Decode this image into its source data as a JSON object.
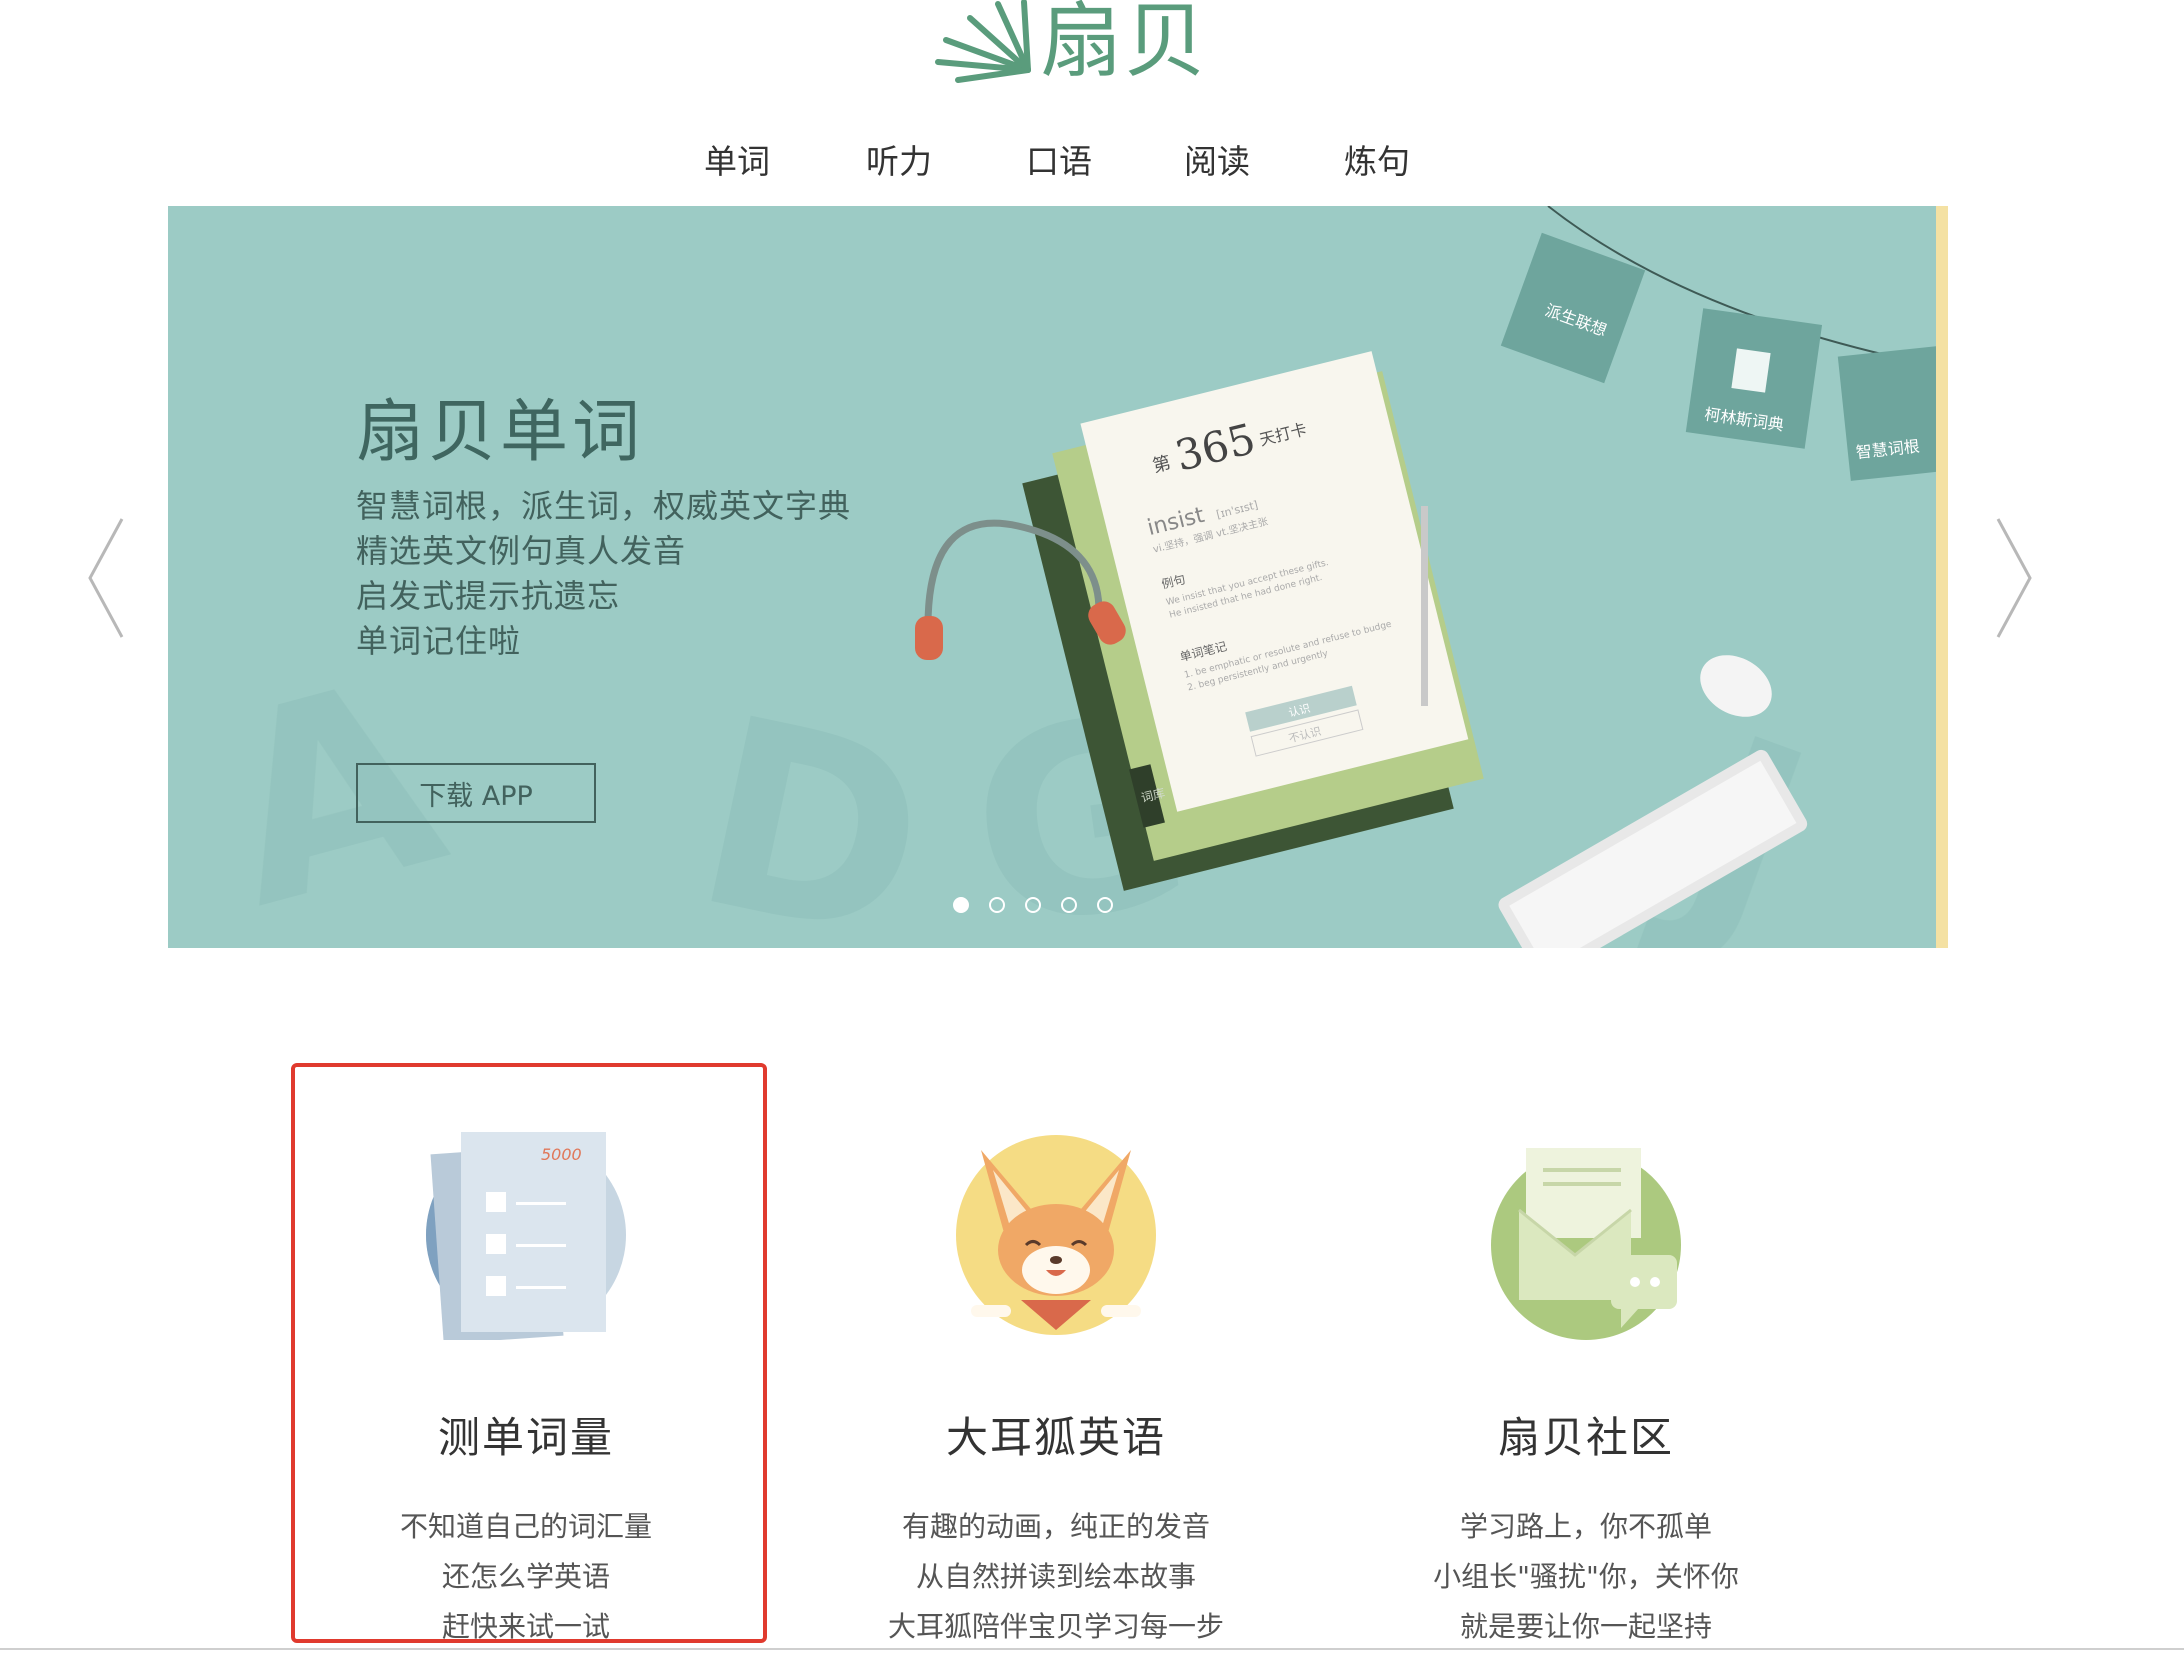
{
  "brand": {
    "name": "扇贝"
  },
  "nav": {
    "items": [
      "单词",
      "听力",
      "口语",
      "阅读",
      "炼句"
    ]
  },
  "banner": {
    "title": "扇贝单词",
    "lines": [
      "智慧词根，派生词，权威英文字典",
      "精选英文例句真人发音",
      "启发式提示抗遗忘",
      "单词记住啦"
    ],
    "button": "下载 APP",
    "slides_total": 5,
    "active_slide": 1,
    "card": {
      "day_prefix": "第",
      "day_number": "365",
      "day_suffix": "天打卡",
      "word": "insist",
      "phonetic": "[ɪn'sɪst]",
      "meaning": "vi.坚持，强调  vt.坚决主张",
      "example_label": "例句",
      "example_1": "We insist that you accept these gifts.",
      "example_2": "He insisted that he had done right.",
      "notes_label": "单词笔记",
      "note_1": "1. be emphatic or resolute and refuse to budge",
      "note_2": "2. beg persistently and urgently",
      "btn_know": "认识",
      "btn_dontknow": "不认识",
      "tab": "词库"
    },
    "tags": [
      "派生联想",
      "柯林斯词典",
      "智慧词根"
    ]
  },
  "features": [
    {
      "title": "测单词量",
      "lines": [
        "不知道自己的词汇量",
        "还怎么学英语",
        "赶快来试一试"
      ],
      "icon": "vocab-test-icon",
      "badge": "5000"
    },
    {
      "title": "大耳狐英语",
      "lines": [
        "有趣的动画，纯正的发音",
        "从自然拼读到绘本故事",
        "大耳狐陪伴宝贝学习每一步"
      ],
      "icon": "fox-icon"
    },
    {
      "title": "扇贝社区",
      "lines": [
        "学习路上，你不孤单",
        "小组长\"骚扰\"你，关怀你",
        "就是要让你一起坚持"
      ],
      "icon": "community-icon"
    }
  ],
  "colors": {
    "brand_green": "#5a9c7c",
    "banner_bg": "#9ccbc5",
    "highlight_red": "#e03a2e"
  }
}
